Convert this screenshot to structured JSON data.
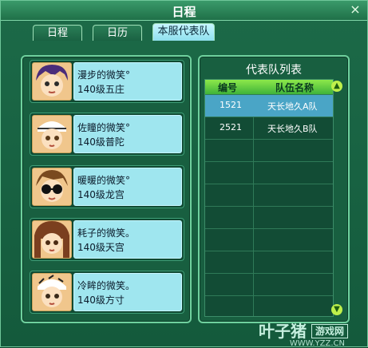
{
  "window": {
    "title": "日程",
    "close_label": "×"
  },
  "tabs": [
    {
      "label": "日程",
      "active": false
    },
    {
      "label": "日历",
      "active": false
    },
    {
      "label": "本服代表队",
      "active": true
    }
  ],
  "members": [
    {
      "name": "漫步的微笑°",
      "level": "140级五庄",
      "avatar": "avatar-purple-hair"
    },
    {
      "name": "佐瞳的微笑°",
      "level": "140级普陀",
      "avatar": "avatar-bandana"
    },
    {
      "name": "暖暖的微笑°",
      "level": "140级龙宫",
      "avatar": "avatar-sunglasses"
    },
    {
      "name": "耗子的微笑。",
      "level": "140级天宫",
      "avatar": "avatar-long-hair"
    },
    {
      "name": "冷眸的微笑。",
      "level": "140级方寸",
      "avatar": "avatar-bandana-2"
    }
  ],
  "team_list": {
    "title": "代表队列表",
    "columns": [
      "编号",
      "队伍名称"
    ],
    "rows": [
      {
        "id": "1521",
        "name": "天长地久A队",
        "selected": true
      },
      {
        "id": "2521",
        "name": "天长地久B队",
        "selected": false
      }
    ]
  },
  "watermark": {
    "brand": "叶子猪",
    "badge": "游戏网",
    "url": "WWW.YZZ.CN"
  },
  "icons": {
    "close": "close-icon",
    "scroll_up": "scroll-up-icon",
    "scroll_down": "scroll-down-icon"
  }
}
